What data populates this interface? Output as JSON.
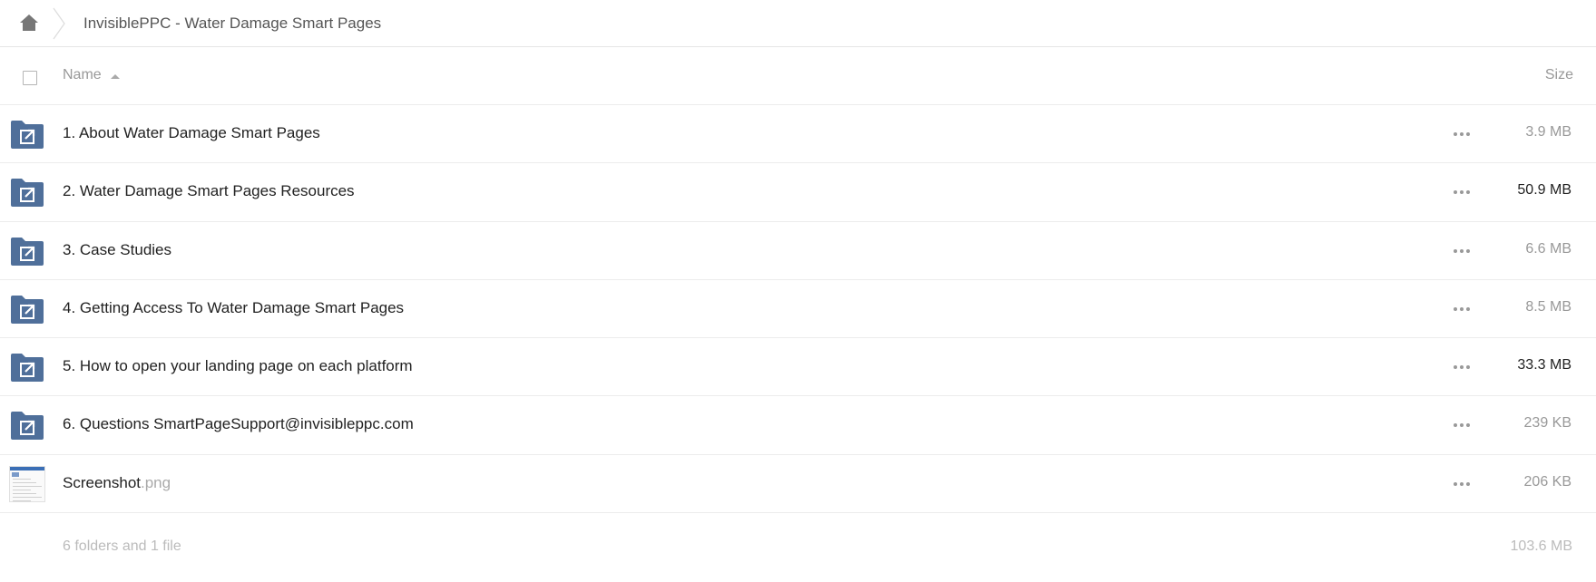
{
  "breadcrumb": {
    "home_icon": "home-icon",
    "title": "InvisiblePPC - Water Damage Smart Pages"
  },
  "header": {
    "name_label": "Name",
    "size_label": "Size",
    "sort": "ascending"
  },
  "files": [
    {
      "name": "1. About Water Damage Smart Pages",
      "ext": "",
      "size": "3.9 MB",
      "type": "shared-folder",
      "size_color": "#999999"
    },
    {
      "name": "2. Water Damage Smart Pages Resources",
      "ext": "",
      "size": "50.9 MB",
      "type": "shared-folder",
      "size_color": "#222222"
    },
    {
      "name": "3. Case Studies",
      "ext": "",
      "size": "6.6 MB",
      "type": "shared-folder",
      "size_color": "#999999"
    },
    {
      "name": "4. Getting Access To Water Damage Smart Pages",
      "ext": "",
      "size": "8.5 MB",
      "type": "shared-folder",
      "size_color": "#999999"
    },
    {
      "name": "5. How to open your landing page on each platform",
      "ext": "",
      "size": "33.3 MB",
      "type": "shared-folder",
      "size_color": "#222222"
    },
    {
      "name": "6. Questions SmartPageSupport@invisibleppc.com",
      "ext": "",
      "size": "239 KB",
      "type": "shared-folder",
      "size_color": "#999999"
    },
    {
      "name": "Screenshot",
      "ext": ".png",
      "size": "206 KB",
      "type": "image-thumbnail",
      "size_color": "#999999"
    }
  ],
  "summary": {
    "text": "6 folders and 1 file",
    "total_size": "103.6 MB"
  },
  "colors": {
    "folder_icon": "#4f6f9a",
    "muted_text": "#999999",
    "border": "#ececec"
  }
}
